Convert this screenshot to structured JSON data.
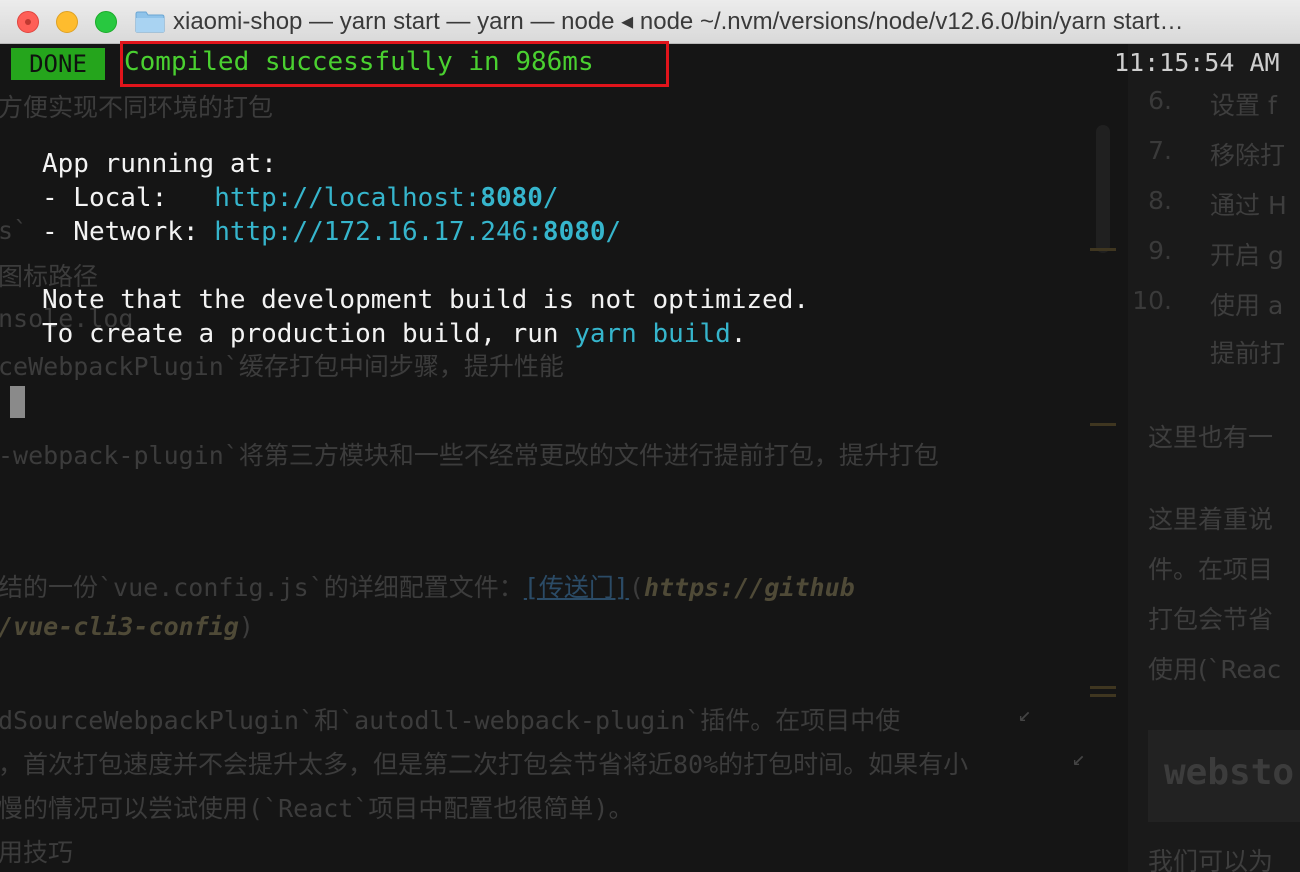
{
  "window": {
    "title": "xiaomi-shop — yarn start — yarn — node ◂ node ~/.nvm/versions/node/v12.6.0/bin/yarn start…"
  },
  "terminal": {
    "badge": "DONE",
    "status": "Compiled successfully in 986ms",
    "time": "11:15:54 AM",
    "app_running": "App running at:",
    "local_label": "- Local:   ",
    "local_url_prefix": "http://localhost:",
    "local_port": "8080",
    "local_url_suffix": "/",
    "network_label": "- Network: ",
    "network_url_prefix": "http://172.16.17.246:",
    "network_port": "8080",
    "network_url_suffix": "/",
    "note_line": "Note that the development build is not optimized.",
    "create_prefix": "To create a production build, run ",
    "create_cmd": "yarn build",
    "create_suffix": "."
  },
  "background_doc": {
    "left": [
      "方便实现不同环境的打包",
      "s`",
      "图标路径",
      "nsole.log",
      "ceWebpackPlugin`缓存打包中间步骤，提升性能",
      "-webpack-plugin`将第三方模块和一些不经常更改的文件进行提前打包，提升打包",
      "结的一份`vue.config.js`的详细配置文件：",
      "[传送门]",
      "(",
      "https://github",
      "/vue-cli3-config",
      ")",
      "dSourceWebpackPlugin`和`autodll-webpack-plugin`插件。在项目中使",
      "，首次打包速度并不会提升太多，但是第二次打包会节省将近80%的打包时间。如果有小",
      "慢的情况可以尝试使用(`React`项目中配置也很简单)。",
      "用技巧"
    ],
    "right_list": [
      {
        "num": "6.",
        "text": "设置 f"
      },
      {
        "num": "7.",
        "text": "移除打"
      },
      {
        "num": "8.",
        "text": "通过 H"
      },
      {
        "num": "9.",
        "text": "开启 g"
      },
      {
        "num": "10.",
        "text": "使用 a"
      },
      {
        "num": "",
        "text": "提前打"
      }
    ],
    "right_paragraphs": [
      "这里也有一",
      "这里着重说",
      "件。在项目",
      "打包会节省",
      "使用(`Reac",
      "我们可以为"
    ],
    "right_heading": "websto"
  }
}
